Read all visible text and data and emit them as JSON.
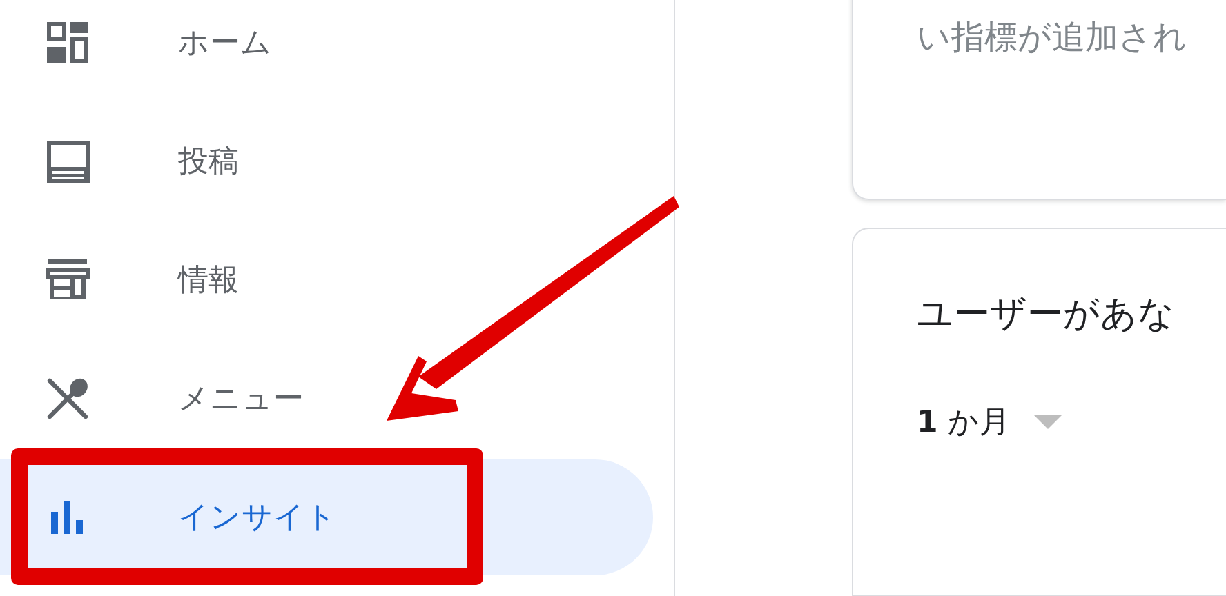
{
  "sidebar": {
    "items": [
      {
        "label": "ホーム",
        "selected": false
      },
      {
        "label": "投稿",
        "selected": false
      },
      {
        "label": "情報",
        "selected": false
      },
      {
        "label": "メニュー",
        "selected": false
      },
      {
        "label": "インサイト",
        "selected": true
      }
    ]
  },
  "cards": [
    {
      "text": "い指標が追加され"
    },
    {
      "title": "ユーザーがあな",
      "period": "**1** か月"
    }
  ],
  "annotation": {
    "highlight_box": true,
    "arrow": true
  }
}
